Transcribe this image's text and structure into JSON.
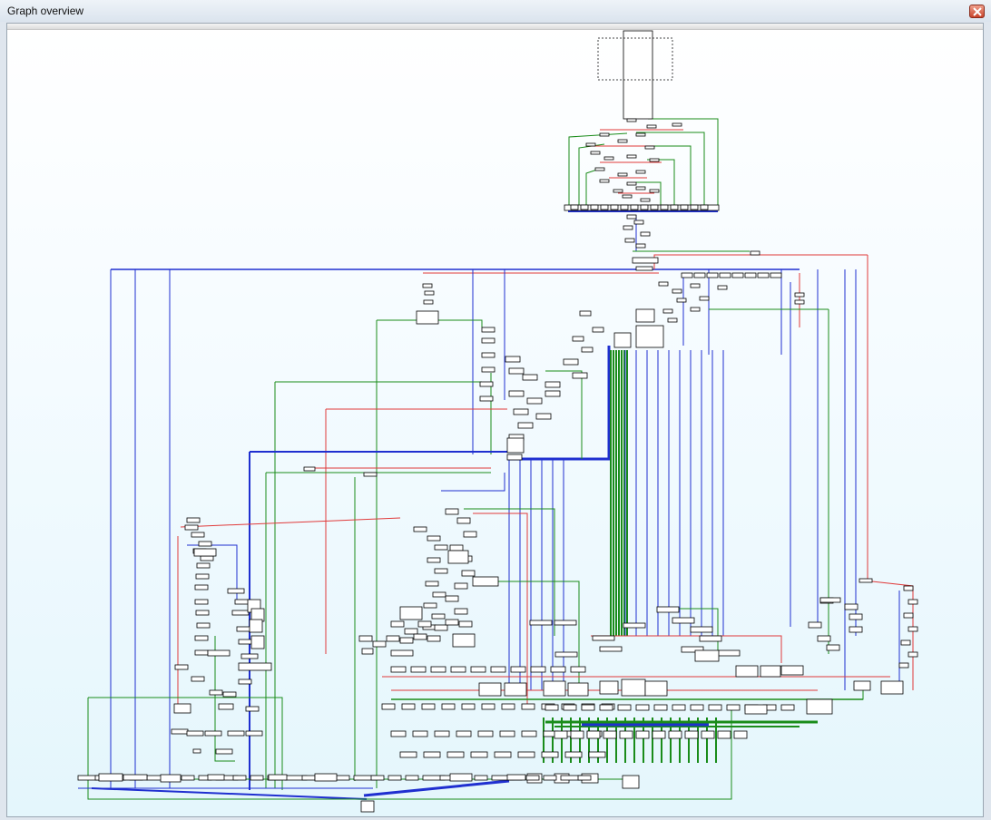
{
  "window": {
    "title": "Graph overview",
    "close_icon": "close-icon"
  },
  "colors": {
    "true_branch": "#1a8c1a",
    "false_branch": "#e03a3a",
    "jump": "#1f2fd0",
    "node_fill": "#ffffff",
    "node_border": "#000000"
  }
}
